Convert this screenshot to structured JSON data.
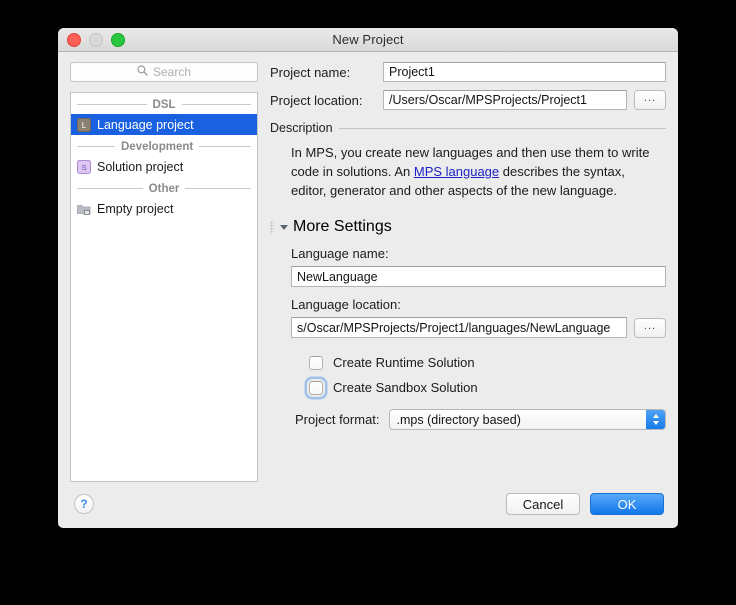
{
  "window": {
    "title": "New Project",
    "traffic_lights": [
      "close",
      "minimize",
      "zoom"
    ]
  },
  "sidebar": {
    "search": {
      "placeholder": "Search",
      "value": "",
      "icon": "search-icon"
    },
    "groups": [
      {
        "label": "DSL",
        "items": [
          {
            "label": "Language project",
            "icon": "language-project-icon",
            "selected": true
          }
        ]
      },
      {
        "label": "Development",
        "items": [
          {
            "label": "Solution project",
            "icon": "solution-project-icon",
            "selected": false
          }
        ]
      },
      {
        "label": "Other",
        "items": [
          {
            "label": "Empty project",
            "icon": "folder-icon",
            "selected": false
          }
        ]
      }
    ]
  },
  "form": {
    "project_name": {
      "label": "Project name:",
      "value": "Project1"
    },
    "project_location": {
      "label": "Project location:",
      "value": "/Users/Oscar/MPSProjects/Project1",
      "browse_label": "..."
    }
  },
  "description": {
    "heading": "Description",
    "text_before_link": "In MPS, you create new languages and then use them to write code in solutions. An ",
    "link_text": "MPS language",
    "text_after_link": " describes the syntax, editor, generator and other aspects of the new language."
  },
  "more_settings": {
    "heading": "More Settings",
    "expanded": true,
    "language_name": {
      "label": "Language name:",
      "value": "NewLanguage"
    },
    "language_location": {
      "label": "Language location:",
      "value": "s/Oscar/MPSProjects/Project1/languages/NewLanguage",
      "browse_label": "..."
    },
    "checkboxes": [
      {
        "label": "Create Runtime Solution",
        "checked": false,
        "focused": false
      },
      {
        "label": "Create Sandbox Solution",
        "checked": false,
        "focused": true
      }
    ],
    "project_format": {
      "label": "Project format:",
      "value": ".mps (directory based)",
      "options": [
        ".mps (directory based)"
      ]
    }
  },
  "footer": {
    "help_label": "?",
    "cancel_label": "Cancel",
    "ok_label": "OK"
  },
  "colors": {
    "selection_blue": "#1961e0",
    "accent_blue": "#1277ec",
    "link_blue": "#1b22c7",
    "window_bg": "#ececec",
    "desktop_bg": "#000000"
  }
}
